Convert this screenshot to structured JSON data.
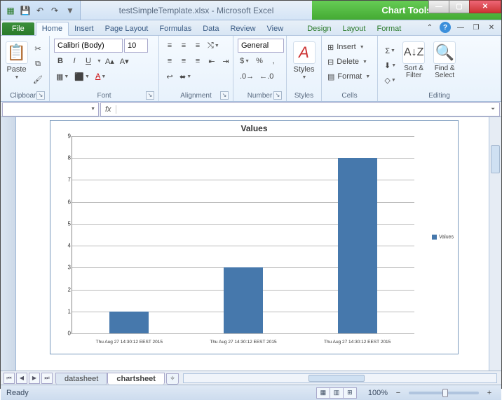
{
  "title": {
    "doc": "testSimpleTemplate.xlsx - Microsoft Excel",
    "context": "Chart Tools"
  },
  "qat": {
    "save": "💾",
    "undo": "↶",
    "redo": "↷"
  },
  "tabs": {
    "file": "File",
    "items": [
      "Home",
      "Insert",
      "Page Layout",
      "Formulas",
      "Data",
      "Review",
      "View"
    ],
    "contextual": [
      "Design",
      "Layout",
      "Format"
    ]
  },
  "ribbon": {
    "clipboard": {
      "label": "Clipboard",
      "paste": "Paste"
    },
    "font": {
      "label": "Font",
      "name": "Calibri (Body)",
      "size": "10",
      "buttons": {
        "bold": "B",
        "italic": "I",
        "underline": "U"
      }
    },
    "alignment": {
      "label": "Alignment",
      "wrap": "Wrap Text",
      "merge": "Merge & Center"
    },
    "number": {
      "label": "Number",
      "format": "General"
    },
    "styles": {
      "label": "Styles",
      "btn": "Styles"
    },
    "cells": {
      "label": "Cells",
      "insert": "Insert",
      "delete": "Delete",
      "format": "Format"
    },
    "editing": {
      "label": "Editing",
      "sort": "Sort & Filter",
      "find": "Find & Select"
    }
  },
  "formula_bar": {
    "name_box": "",
    "fx": "fx"
  },
  "chart_data": {
    "type": "bar",
    "title": "Values",
    "categories": [
      "Thu Aug 27 14:30:12 EEST 2015",
      "Thu Aug 27 14:30:12 EEST 2015",
      "Thu Aug 27 14:30:12 EEST 2015"
    ],
    "values": [
      1,
      3,
      8
    ],
    "series_name": "Values",
    "ylim": [
      0,
      9
    ],
    "yticks": [
      0,
      1,
      2,
      3,
      4,
      5,
      6,
      7,
      8,
      9
    ],
    "color": "#4678ac"
  },
  "sheets": {
    "tabs": [
      "datasheet",
      "chartsheet"
    ],
    "active": 1
  },
  "status": {
    "ready": "Ready",
    "zoom": "100%"
  }
}
